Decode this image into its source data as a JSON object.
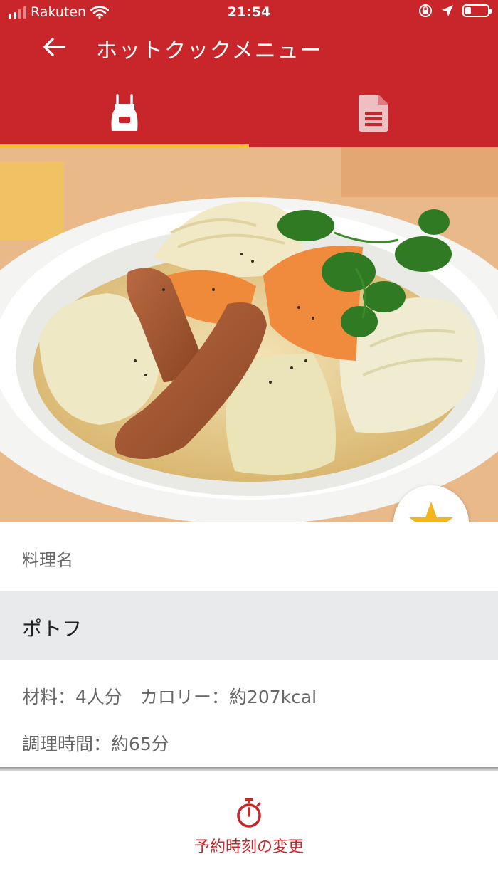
{
  "status_bar": {
    "carrier": "Rakuten",
    "time": "21:54"
  },
  "header": {
    "title": "ホットクックメニュー"
  },
  "tabs": [
    {
      "name": "cooking",
      "icon": "apron-icon",
      "selected": true
    },
    {
      "name": "recipe",
      "icon": "document-icon",
      "selected": false
    }
  ],
  "recipe": {
    "name_label": "料理名",
    "name": "ポトフ",
    "info_line1": "材料：4人分　カロリー：約207kcal",
    "info_line2": "調理時間：約65分"
  },
  "footer": {
    "reserve_label": "予約時刻の変更"
  },
  "colors": {
    "brand_red": "#c8262b",
    "tab_indicator": "#f6c21b",
    "favorite_star": "#f2b51c"
  }
}
